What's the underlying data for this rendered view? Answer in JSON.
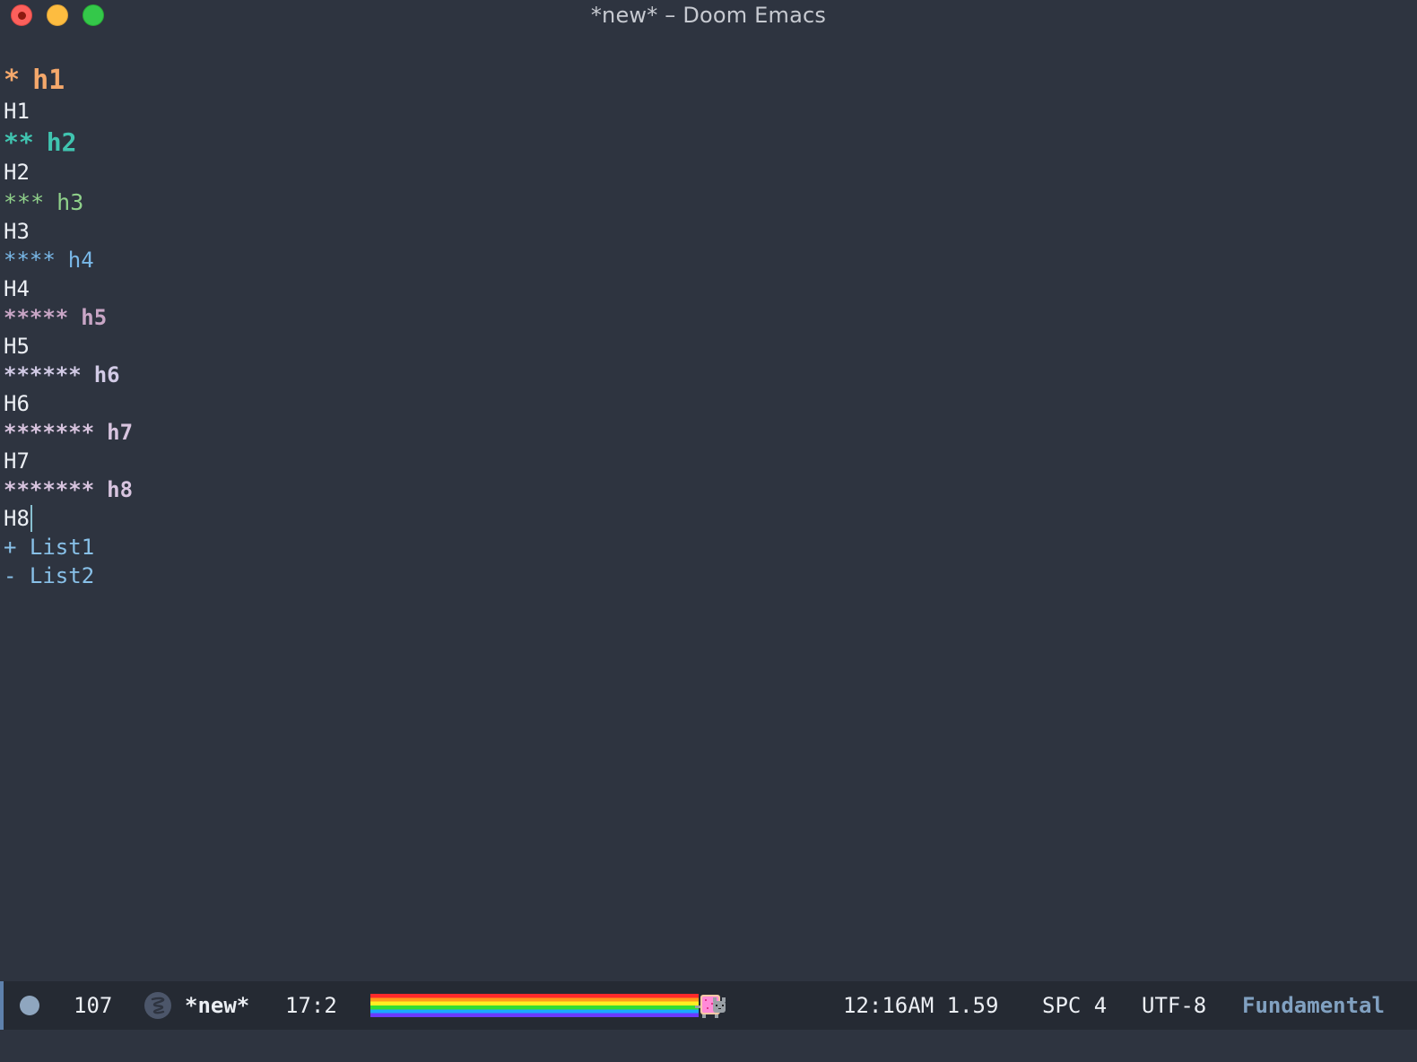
{
  "window": {
    "title": "*new* – Doom Emacs"
  },
  "editor": {
    "lines": [
      {
        "stars": "*",
        "text": "h1"
      },
      {
        "text": "H1"
      },
      {
        "stars": "**",
        "text": "h2"
      },
      {
        "text": "H2"
      },
      {
        "stars": "***",
        "text": "h3"
      },
      {
        "text": "H3"
      },
      {
        "stars": "****",
        "text": "h4"
      },
      {
        "text": "H4"
      },
      {
        "stars": "*****",
        "text": "h5"
      },
      {
        "text": "H5"
      },
      {
        "stars": "******",
        "text": "h6"
      },
      {
        "text": "H6"
      },
      {
        "stars": "*******",
        "text": "h7"
      },
      {
        "text": "H7"
      },
      {
        "stars": "*******",
        "text": "h8"
      },
      {
        "text": "H8"
      },
      {
        "bullet": "+",
        "text": "List1"
      },
      {
        "bullet": "-",
        "text": "List2"
      }
    ]
  },
  "modeline": {
    "line_count": "107",
    "buffer_name": "*new*",
    "position": "17:2",
    "scroll_fraction": 0.9,
    "time_load": "12:16AM 1.59",
    "indent": "SPC 4",
    "encoding": "UTF-8",
    "major_mode": "Fundamental"
  },
  "icons": {
    "status_dot": "circle-icon",
    "emacs": "emacs-logo-icon",
    "nyan": "nyan-cat-icon"
  },
  "colors": {
    "background": "#2e3440",
    "modeline_bg": "#252a33",
    "h1": "#f5a86b",
    "h2": "#40c4b0",
    "h3": "#8fd08a",
    "h4": "#79b8e8",
    "h5": "#c9a6c6",
    "h6": "#d2cbe6",
    "list": "#88c0e8",
    "major_mode": "#81a1c1"
  }
}
